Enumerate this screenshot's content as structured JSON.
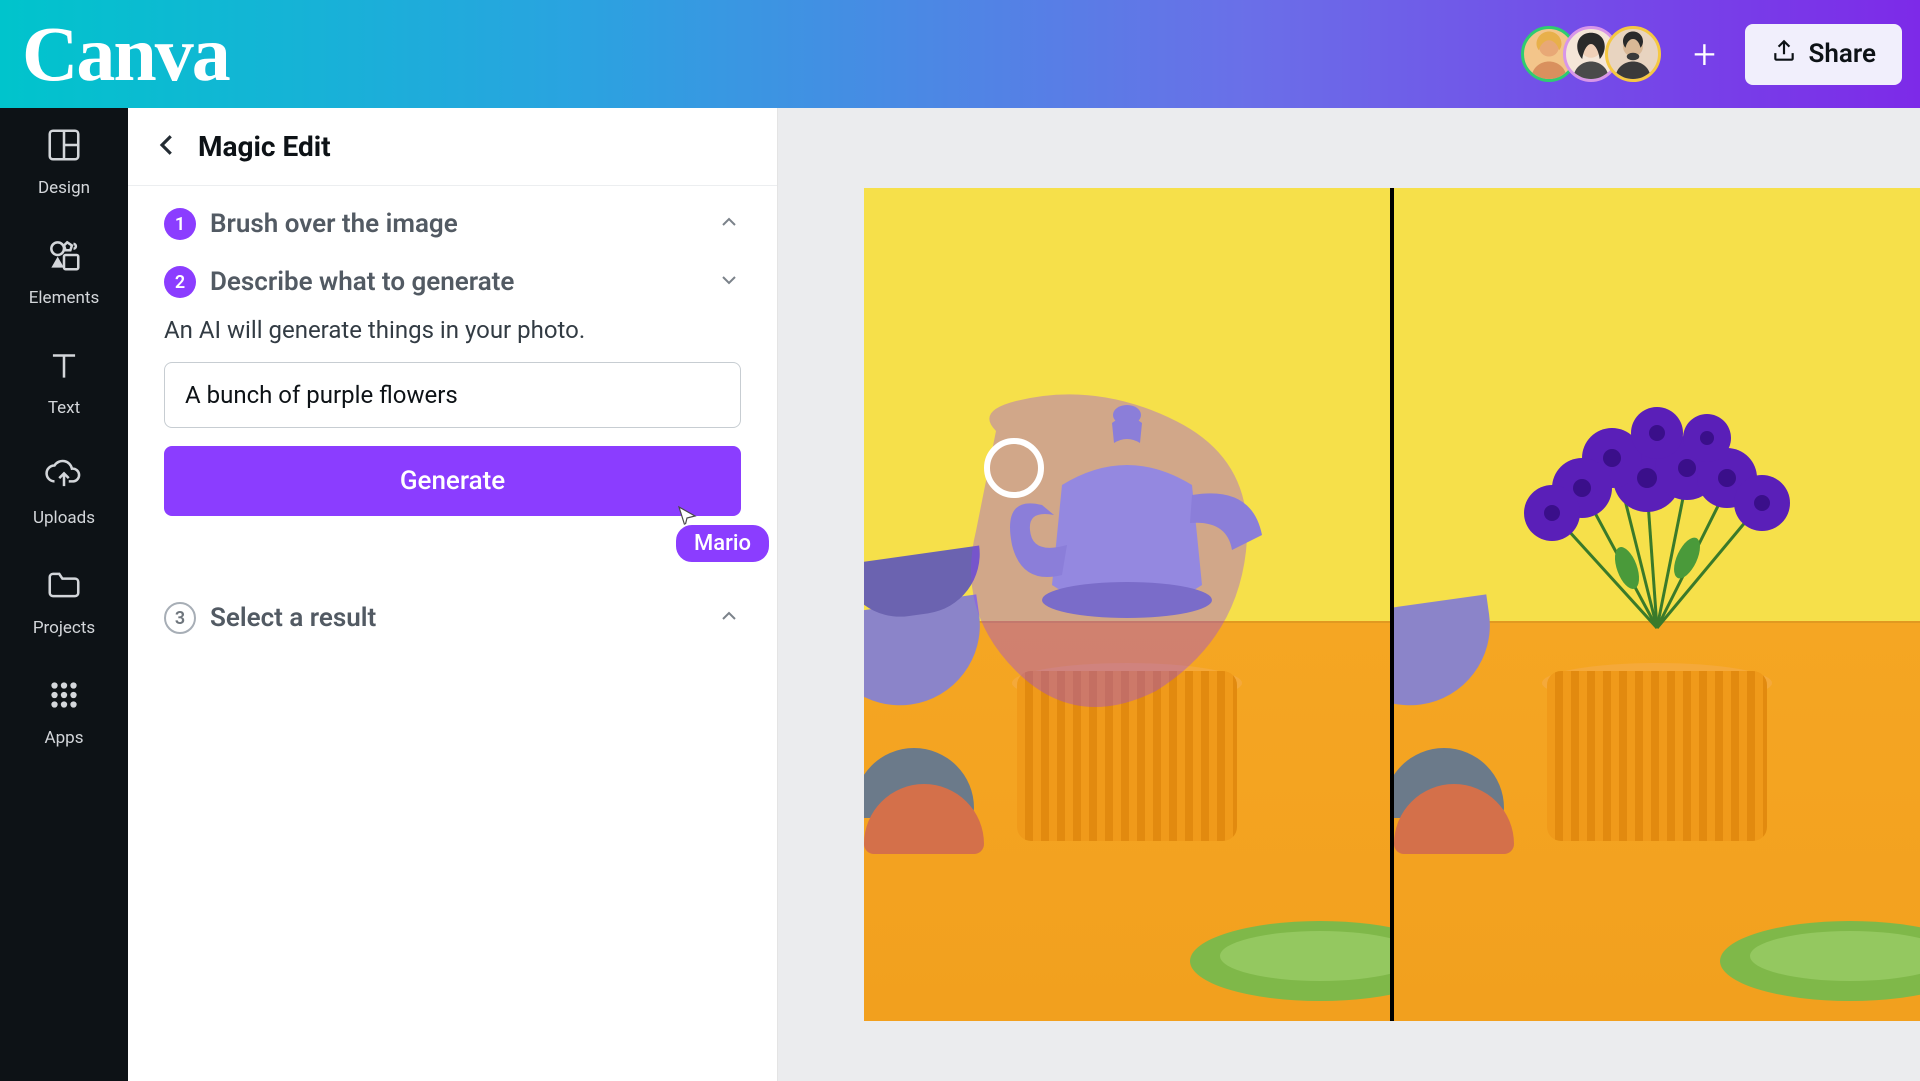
{
  "app": {
    "name": "Canva"
  },
  "header": {
    "share_label": "Share",
    "collaborators": [
      "User 1",
      "User 2",
      "User 3"
    ],
    "avatar_borders": [
      "#2ecc71",
      "#d896e8",
      "#f5c842"
    ]
  },
  "sidebar": {
    "items": [
      {
        "label": "Design",
        "icon": "layout-icon"
      },
      {
        "label": "Elements",
        "icon": "shapes-icon"
      },
      {
        "label": "Text",
        "icon": "text-icon"
      },
      {
        "label": "Uploads",
        "icon": "cloud-upload-icon"
      },
      {
        "label": "Projects",
        "icon": "folder-icon"
      },
      {
        "label": "Apps",
        "icon": "grid-icon"
      }
    ]
  },
  "panel": {
    "title": "Magic Edit",
    "steps": [
      {
        "num": "1",
        "title": "Brush over the image",
        "expanded": false,
        "filled": true
      },
      {
        "num": "2",
        "title": "Describe what to generate",
        "expanded": true,
        "filled": true
      },
      {
        "num": "3",
        "title": "Select a result",
        "expanded": false,
        "filled": false
      }
    ],
    "describe_hint": "An AI will generate things in your photo.",
    "prompt_value": "A bunch of purple flowers",
    "generate_label": "Generate",
    "cursor_user": "Mario"
  },
  "colors": {
    "accent": "#8b3dff"
  }
}
